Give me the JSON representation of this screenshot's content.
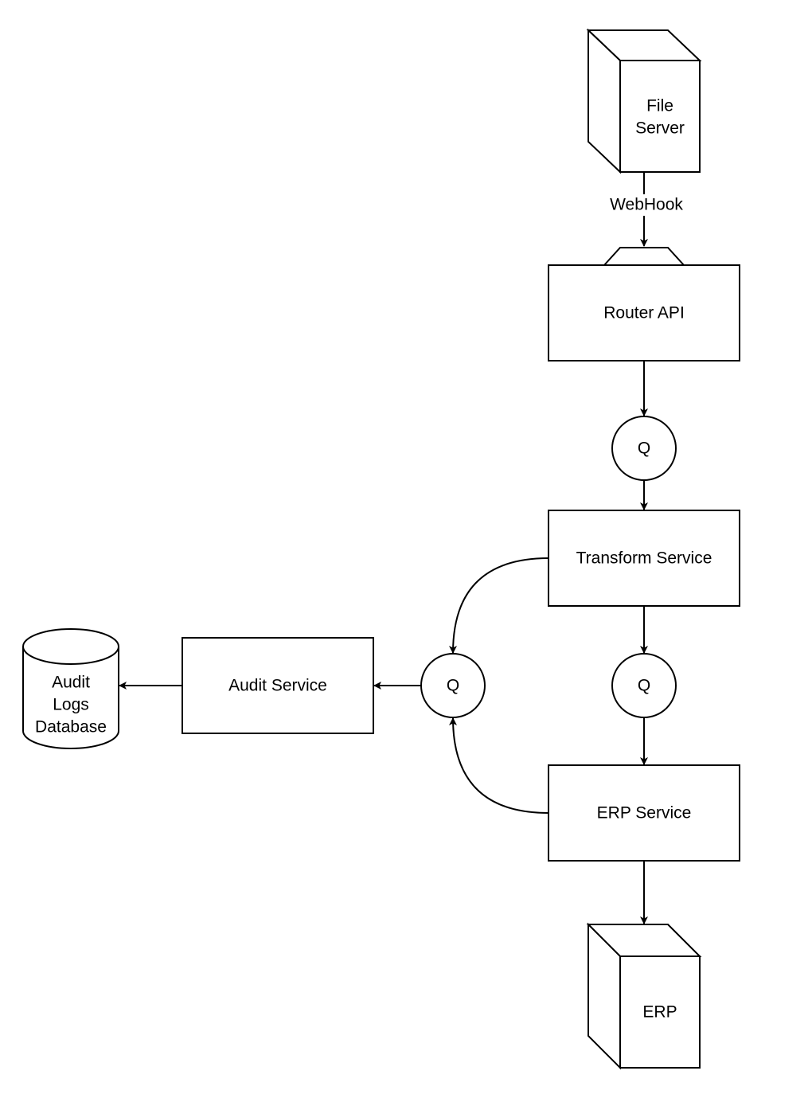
{
  "nodes": {
    "file_server": {
      "lines": [
        "File",
        "Server"
      ],
      "shape": "cube"
    },
    "router_api": {
      "label": "Router API",
      "shape": "rectangle-with-tab"
    },
    "queue_1": {
      "label": "Q",
      "shape": "circle"
    },
    "transform_service": {
      "label": "Transform Service",
      "shape": "rectangle"
    },
    "queue_2": {
      "label": "Q",
      "shape": "circle"
    },
    "queue_audit": {
      "label": "Q",
      "shape": "circle"
    },
    "audit_service": {
      "label": "Audit Service",
      "shape": "rectangle"
    },
    "audit_db": {
      "lines": [
        "Audit",
        "Logs",
        "Database"
      ],
      "shape": "cylinder"
    },
    "erp_service": {
      "label": "ERP Service",
      "shape": "rectangle"
    },
    "erp": {
      "label": "ERP",
      "shape": "cube"
    }
  },
  "edges": [
    {
      "from": "file_server",
      "to": "router_api",
      "label": "WebHook"
    },
    {
      "from": "router_api",
      "to": "queue_1"
    },
    {
      "from": "queue_1",
      "to": "transform_service"
    },
    {
      "from": "transform_service",
      "to": "queue_2"
    },
    {
      "from": "queue_2",
      "to": "erp_service"
    },
    {
      "from": "erp_service",
      "to": "erp"
    },
    {
      "from": "transform_service",
      "to": "queue_audit"
    },
    {
      "from": "erp_service",
      "to": "queue_audit"
    },
    {
      "from": "queue_audit",
      "to": "audit_service"
    },
    {
      "from": "audit_service",
      "to": "audit_db"
    }
  ]
}
